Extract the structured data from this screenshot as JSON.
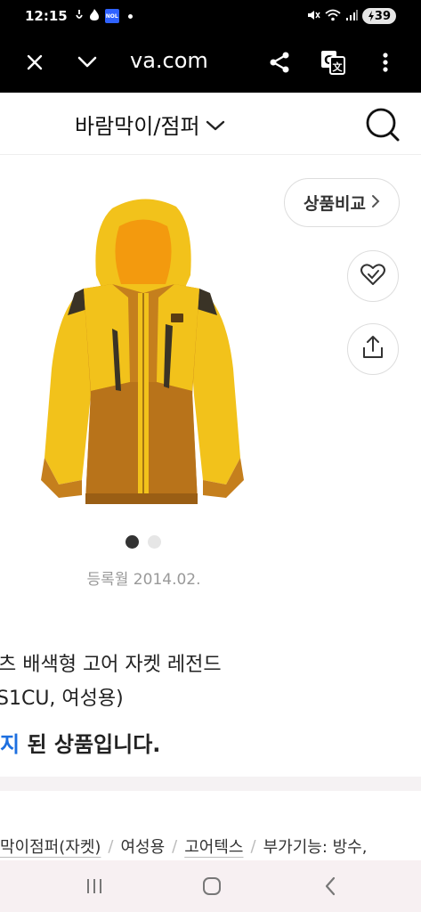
{
  "status_bar": {
    "time": "12:15",
    "nol_badge": "NOL",
    "battery": "39",
    "icons": [
      "vibrate-icon",
      "flame-icon",
      "nol-app-icon",
      "notification-dot-icon",
      "mute-icon",
      "wifi-icon",
      "signal-icon",
      "battery-charging-icon"
    ]
  },
  "browser": {
    "url": "va.com",
    "icons": [
      "close-icon",
      "chevron-down-icon",
      "share-icon",
      "translate-icon",
      "more-vertical-icon"
    ]
  },
  "header": {
    "category": "바람막이/점퍼",
    "icons": [
      "chevron-down-icon",
      "search-icon"
    ]
  },
  "product": {
    "compare_label": "상품비교",
    "registered": "등록월 2014.02.",
    "title_line1": "츠 배색형 고어 자켓 레전드",
    "title_line2": "S1CU, 여성용)",
    "status_accent": "지",
    "status_rest": " 된 상품입니다.",
    "image_colors": {
      "yellow": "#f2c21b",
      "brown": "#c57f1d",
      "dark": "#3a3326",
      "hood_inner": "#f39a0e"
    },
    "gallery": {
      "total": 2,
      "active": 1
    }
  },
  "specs": {
    "items": [
      {
        "text": "막이점퍼(자켓)",
        "link": true
      },
      {
        "text": "여성용",
        "link": false
      },
      {
        "text": "고어텍스",
        "link": true
      },
      {
        "text": "부가기능: 방수,",
        "link": false
      }
    ],
    "separator": "/"
  },
  "nav": {
    "icons": [
      "recent-apps-icon",
      "home-icon",
      "back-icon"
    ]
  }
}
